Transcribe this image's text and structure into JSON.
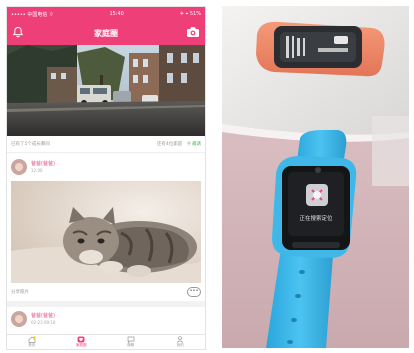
{
  "status_bar": {
    "carrier": "••••• 中国电信 ⌔",
    "time": "15:40",
    "battery": "✈ ⌖ 51%"
  },
  "header": {
    "title": "家庭圈",
    "bell_icon": "bell-icon",
    "camera_icon": "camera-plus-icon"
  },
  "info_bar": {
    "left_text": "已有了5个成长瞬间",
    "right_text": "还有4位家庭",
    "invite_label": "邀请"
  },
  "post1": {
    "author": "爸爸(爸爸)",
    "time": "12:00",
    "caption": "分享照片",
    "comment_glyph": "•••"
  },
  "post2": {
    "author": "爸爸(爸爸)",
    "time": "02-23 09:10"
  },
  "tab_bar": {
    "tabs": [
      {
        "label": "首页",
        "icon": "home-icon",
        "active": false
      },
      {
        "label": "家庭圈",
        "icon": "heart-icon",
        "active": true
      },
      {
        "label": "微聊",
        "icon": "chat-icon",
        "active": false
      },
      {
        "label": "我的",
        "icon": "user-icon",
        "active": false
      }
    ]
  },
  "watch": {
    "screen_text": "正在搜索定位",
    "colors": {
      "strap_blue": "#3fb8e8",
      "strap_orange": "#f08a6c",
      "surface_pink": "#d7b9bd",
      "wall": "#eceaea"
    }
  },
  "colors": {
    "brand": "#ef3f79",
    "invite_green": "#4caf50"
  }
}
